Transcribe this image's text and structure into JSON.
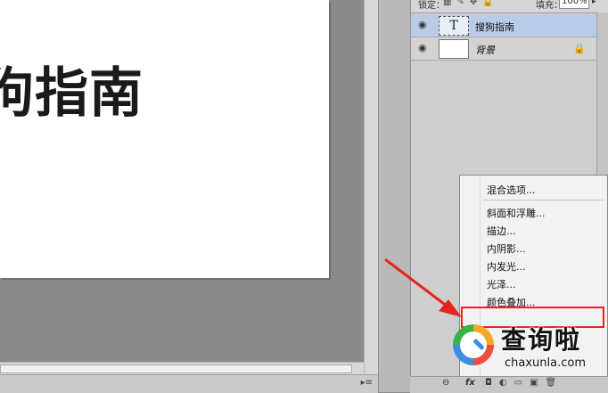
{
  "document": {
    "text": "狗指南"
  },
  "layers_panel": {
    "lock_label": "锁定：",
    "fill_label": "填充：",
    "fill_value": "100%",
    "layers": [
      {
        "name": "搜狗指南",
        "thumb": "T",
        "selected": true
      },
      {
        "name": "背景",
        "locked": true,
        "selected": false
      }
    ]
  },
  "context_menu": {
    "items": [
      "混合选项...",
      "斜面和浮雕...",
      "描边...",
      "内阴影...",
      "内发光...",
      "光泽...",
      "颜色叠加..."
    ]
  },
  "panel_footer": {
    "fx_label": "fx"
  },
  "watermark": {
    "title": "查询啦",
    "url": "chaxunla.com"
  },
  "colors": {
    "highlight": "#e8241f",
    "arrow": "#e8241f",
    "selected_layer": "#b8cce8"
  }
}
